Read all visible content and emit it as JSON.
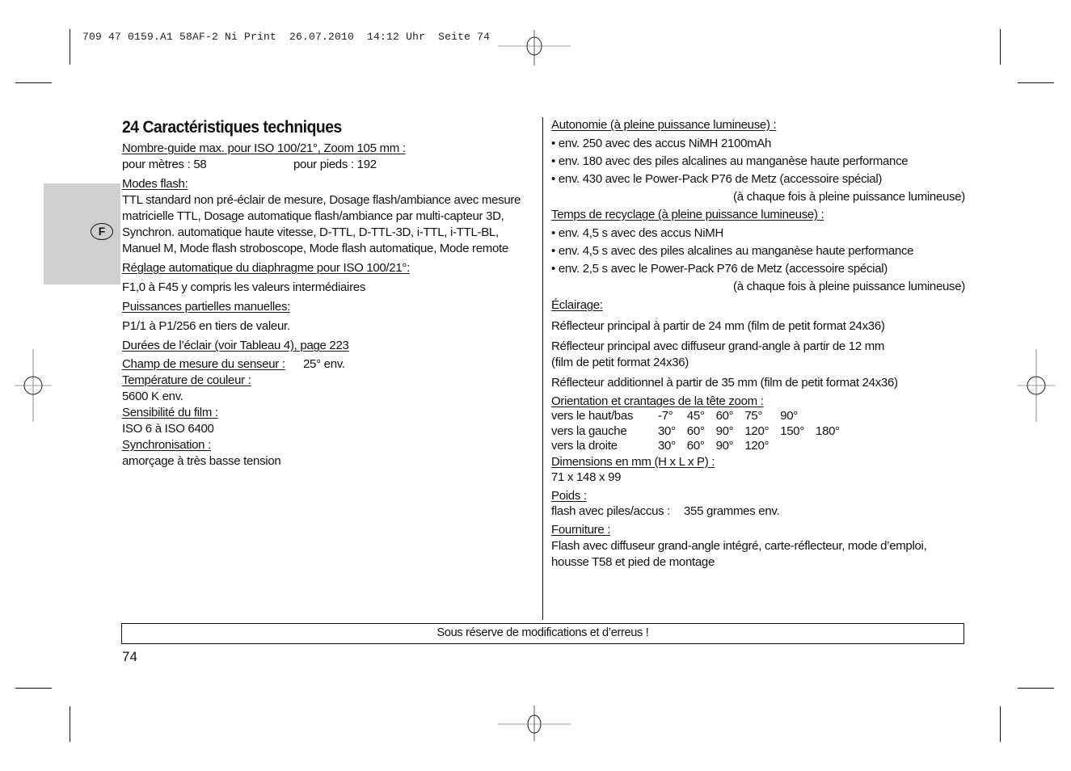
{
  "slug": "709 47 0159.A1 58AF-2 Ni Print  26.07.2010  14:12 Uhr  Seite 74",
  "language_tab": "F",
  "title": "24 Caractéristiques techniques",
  "left": {
    "guide_number": {
      "label": "Nombre-guide max. pour ISO 100/21°, Zoom 105 mm :",
      "meters": "pour mètres : 58",
      "feet": "pour pieds : 192"
    },
    "flash_modes": {
      "label": "Modes flash:",
      "lines": [
        "TTL standard non pré-éclair de mesure, Dosage flash/ambiance avec mesure",
        "matricielle TTL, Dosage automatique flash/ambiance par multi-capteur 3D,",
        "Synchron. automatique haute vitesse, D-TTL, D-TTL-3D, i-TTL, i-TTL-BL,",
        "Manuel M, Mode flash stroboscope, Mode flash automatique, Mode remote"
      ]
    },
    "aperture": {
      "label": "Réglage automatique du diaphragme pour ISO 100/21°:",
      "value": "F1,0 à F45 y compris les valeurs intermédiaires"
    },
    "partial_power": {
      "label": "Puissances partielles manuelles:",
      "value": "P1/1 à P1/256 en tiers de valeur."
    },
    "flash_duration": {
      "label": "Durées de l’éclair (voir Tableau 4), page 223"
    },
    "sensor_field": {
      "label": "Champ de mesure du senseur :",
      "value": "25° env."
    },
    "color_temp": {
      "label": "Température de couleur :",
      "value": "5600 K env."
    },
    "film_speed": {
      "label": "Sensibilité du film :",
      "value": "ISO 6 à ISO 6400"
    },
    "sync": {
      "label": "Synchronisation :",
      "value": "amorçage à très basse tension"
    }
  },
  "right": {
    "autonomy": {
      "label": "Autonomie (à pleine puissance lumineuse) :",
      "items": [
        "env. 250 avec des accus NiMH 2100mAh",
        "env. 180 avec des piles alcalines au manganèse haute performance",
        "env. 430 avec le Power-Pack P76 de Metz (accessoire spécial)"
      ],
      "note": "(à chaque fois à pleine puissance lumineuse)"
    },
    "recycle": {
      "label": "Temps de recyclage (à pleine puissance lumineuse) :",
      "items": [
        "env. 4,5 s avec des accus NiMH",
        "env. 4,5 s avec des piles alcalines au manganèse haute performance",
        "env. 2,5 s avec le Power-Pack P76 de Metz (accessoire spécial)"
      ],
      "note": "(à chaque fois à pleine puissance lumineuse)"
    },
    "illumination": {
      "label": "Éclairage:",
      "lines": [
        "Réflecteur principal à partir de 24 mm (film de petit format 24x36)",
        "Réflecteur principal avec diffuseur grand-angle à partir de 12 mm",
        "(film de petit format 24x36)",
        "Réflecteur additionnel à partir de 35 mm (film de petit format 24x36)"
      ]
    },
    "orientation": {
      "label": "Orientation et crantages de la tête zoom :",
      "rows": [
        {
          "name": "vers le haut/bas",
          "values": [
            "-7°",
            "45°",
            "60°",
            "75°",
            "90°",
            ""
          ]
        },
        {
          "name": "vers la gauche",
          "values": [
            "30°",
            "60°",
            "90°",
            "120°",
            "150°",
            "180°"
          ]
        },
        {
          "name": "vers la droite",
          "values": [
            "30°",
            "60°",
            "90°",
            "120°",
            "",
            ""
          ]
        }
      ]
    },
    "dimensions": {
      "label": "Dimensions en mm (H x L x P) :",
      "value": "71 x 148 x 99"
    },
    "weight": {
      "label": "Poids :",
      "key": "flash avec piles/accus :",
      "value": "355 grammes env."
    },
    "supply": {
      "label": "Fourniture :",
      "lines": [
        "Flash avec diffuseur grand-angle intégré, carte-réflecteur, mode d’emploi,",
        "housse T58 et pied de montage"
      ]
    }
  },
  "footer": {
    "notice": "Sous réserve de modifications et d’erreus !",
    "page_number": "74"
  }
}
